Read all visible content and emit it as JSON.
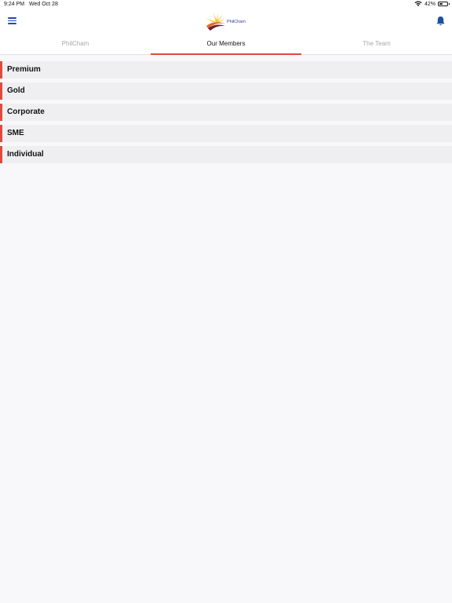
{
  "status_bar": {
    "time": "9:24 PM",
    "date": "Wed Oct 28",
    "battery_percent": "42%",
    "battery_level": 0.42,
    "icons": [
      "wifi-icon",
      "battery-icon"
    ]
  },
  "nav": {
    "menu_icon": "hamburger-menu-icon",
    "logo_text": "PhilCham",
    "notification_icon": "bell-icon",
    "accent_color": "#1b4fa8"
  },
  "tabs": [
    {
      "label": "PhilCham",
      "active": false
    },
    {
      "label": "Our Members",
      "active": true
    },
    {
      "label": "The Team",
      "active": false
    }
  ],
  "members": {
    "accent_color": "#e14a3b",
    "items": [
      {
        "label": "Premium"
      },
      {
        "label": "Gold"
      },
      {
        "label": "Corporate"
      },
      {
        "label": "SME"
      },
      {
        "label": "Individual"
      }
    ]
  }
}
